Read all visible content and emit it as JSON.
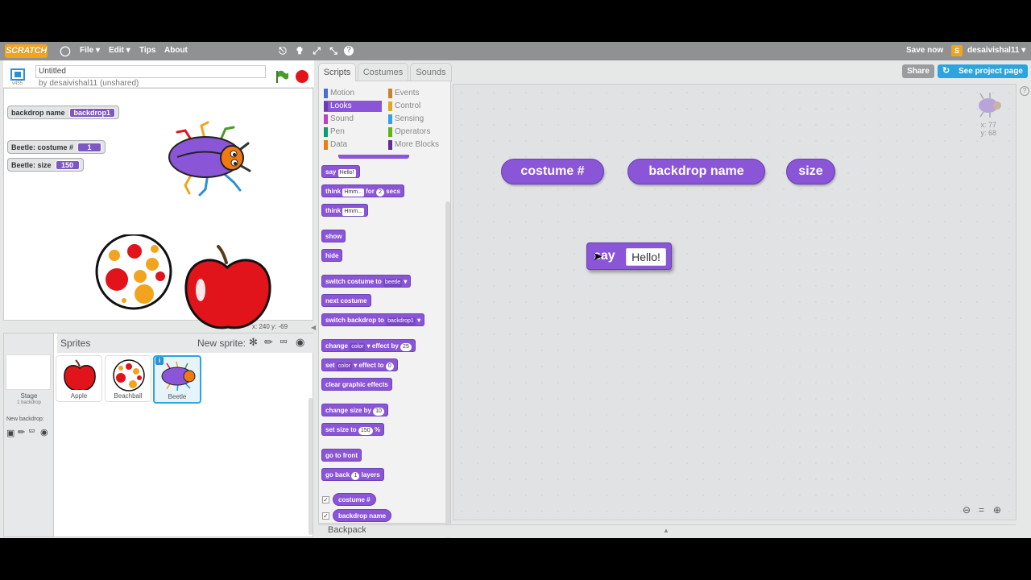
{
  "menubar": {
    "logo": "SCRATCH",
    "file": "File ▾",
    "edit": "Edit ▾",
    "tips": "Tips",
    "about": "About",
    "save_now": "Save now",
    "username": "desaivishal11 ▾"
  },
  "project": {
    "title": "Untitled",
    "byline": "by desaivishal11 (unshared)",
    "version": "v455",
    "share": "Share",
    "see_project_page": "See project page"
  },
  "stage": {
    "monitors": [
      {
        "label": "backdrop name",
        "value": "backdrop1"
      },
      {
        "label": "Beetle: costume #",
        "value": "1"
      },
      {
        "label": "Beetle: size",
        "value": "150"
      }
    ],
    "coords": "x: 240   y: -69"
  },
  "sprites": {
    "header": "Sprites",
    "new_sprite": "New sprite:",
    "stage_label": "Stage",
    "stage_sub": "1 backdrop",
    "new_backdrop": "New backdrop:",
    "items": [
      "Apple",
      "Beachball",
      "Beetle"
    ]
  },
  "tabs": [
    "Scripts",
    "Costumes",
    "Sounds"
  ],
  "categories": [
    {
      "label": "Motion",
      "color": "#4a6cd4"
    },
    {
      "label": "Events",
      "color": "#c88330"
    },
    {
      "label": "Looks",
      "color": "#8a55d7"
    },
    {
      "label": "Control",
      "color": "#e1a91a"
    },
    {
      "label": "Sound",
      "color": "#bb42c3"
    },
    {
      "label": "Sensing",
      "color": "#2ca5e2"
    },
    {
      "label": "Pen",
      "color": "#0e9a6c"
    },
    {
      "label": "Operators",
      "color": "#5cb712"
    },
    {
      "label": "Data",
      "color": "#ee7d16"
    },
    {
      "label": "More Blocks",
      "color": "#632d99"
    }
  ],
  "blocks": {
    "say": "say",
    "say_val": "Hello!",
    "think_for": "think",
    "think_for_val": "Hmm...",
    "for": "for",
    "secs_val": "2",
    "secs": "secs",
    "think": "think",
    "think_val": "Hmm...",
    "show": "show",
    "hide": "hide",
    "switch_costume": "switch costume to",
    "costume_val": "beetle",
    "next_costume": "next costume",
    "switch_backdrop": "switch backdrop to",
    "backdrop_val": "backdrop1",
    "change_effect": "change",
    "effect_val": "color",
    "effect_by": "effect by",
    "effect_by_val": "25",
    "set_effect": "set",
    "set_effect_val": "color",
    "effect_to": "effect to",
    "effect_to_val": "0",
    "clear_effects": "clear graphic effects",
    "change_size": "change size by",
    "change_size_val": "10",
    "set_size": "set size to",
    "set_size_val": "150",
    "pct": "%",
    "go_front": "go to front",
    "go_back": "go back",
    "go_back_val": "1",
    "layers": "layers",
    "costume_num": "costume #",
    "backdrop_name": "backdrop name"
  },
  "scripts_area": {
    "reporters": [
      "costume #",
      "backdrop name",
      "size"
    ],
    "say_label": "say",
    "say_value": "Hello!",
    "sprite_x": "x: 77",
    "sprite_y": "y: 68"
  },
  "backpack": "Backpack"
}
